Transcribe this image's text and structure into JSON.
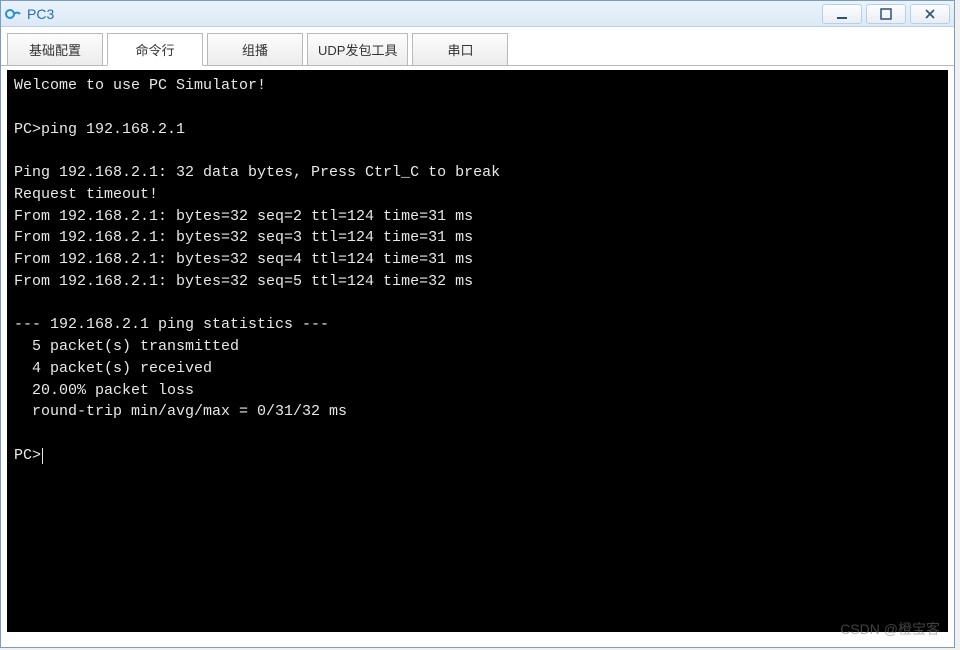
{
  "window": {
    "title": "PC3"
  },
  "tabs": [
    {
      "label": "基础配置",
      "active": false
    },
    {
      "label": "命令行",
      "active": true
    },
    {
      "label": "组播",
      "active": false
    },
    {
      "label": "UDP发包工具",
      "active": false
    },
    {
      "label": "串口",
      "active": false
    }
  ],
  "terminal": {
    "lines": [
      "Welcome to use PC Simulator!",
      "",
      "PC>ping 192.168.2.1",
      "",
      "Ping 192.168.2.1: 32 data bytes, Press Ctrl_C to break",
      "Request timeout!",
      "From 192.168.2.1: bytes=32 seq=2 ttl=124 time=31 ms",
      "From 192.168.2.1: bytes=32 seq=3 ttl=124 time=31 ms",
      "From 192.168.2.1: bytes=32 seq=4 ttl=124 time=31 ms",
      "From 192.168.2.1: bytes=32 seq=5 ttl=124 time=32 ms",
      "",
      "--- 192.168.2.1 ping statistics ---",
      "  5 packet(s) transmitted",
      "  4 packet(s) received",
      "  20.00% packet loss",
      "  round-trip min/avg/max = 0/31/32 ms",
      ""
    ],
    "prompt": "PC>"
  },
  "watermark": "CSDN @橙宝客"
}
